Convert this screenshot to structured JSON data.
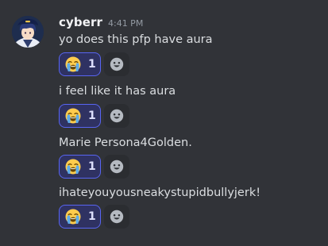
{
  "author": {
    "username": "cyberr",
    "timestamp": "4:41 PM",
    "avatar_icon": "anime-character-avatar"
  },
  "messages": [
    {
      "text": "yo does this pfp have aura",
      "reaction": {
        "emoji": "loudly-crying-face",
        "count": "1"
      }
    },
    {
      "text": "i feel like it has aura",
      "reaction": {
        "emoji": "loudly-crying-face",
        "count": "1"
      }
    },
    {
      "text": "Marie Persona4Golden.",
      "reaction": {
        "emoji": "loudly-crying-face",
        "count": "1"
      }
    },
    {
      "text": "ihateyouyousneakystupidbullyjerk!",
      "reaction": {
        "emoji": "loudly-crying-face",
        "count": "1"
      }
    }
  ],
  "add_reaction_icon": "smiley-face-add-reaction-icon",
  "colors": {
    "background": "#313338",
    "reaction_active_border": "#5865f2",
    "reaction_active_bg": "#2f3262"
  }
}
